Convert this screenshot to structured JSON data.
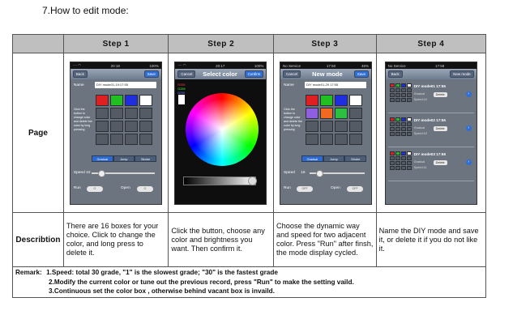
{
  "heading": "7.How to edit mode:",
  "table": {
    "headers": [
      "Step 1",
      "Step 2",
      "Step 3",
      "Step 4"
    ],
    "row_labels": {
      "page": "Page",
      "description": "Describtion"
    },
    "descriptions": [
      "There are 16 boxes for your choice. Click to change the color, and long press to delete it.",
      "Click the button, choose any color and brightness you want. Then confirm it.",
      " Choose the dynamic way and speed for two adjacent color. Press \"Run\" after finsh, the mode display cycled.",
      "Name the DIY mode and save it, or delete it if you do not like it."
    ]
  },
  "remark": {
    "label": "Remark:",
    "lines": [
      "1.Speed: total 30 grade, \"1\" is the slowest grade; \"30\" is the fastest grade",
      "2.Modify the current color or tune out the previous record, press \"Run\" to make the setting vaild.",
      "3.Continuous set the color box , otherwise behind vacant box is invaild."
    ]
  },
  "phones": {
    "step1": {
      "status_left": "∙∙∙∙ ◠",
      "status_time": "20:18",
      "status_right": "100%",
      "back": "Back",
      "save": "Save",
      "name_label": "Name",
      "name_value": "DIY mode01-19:17:55",
      "side_text": "Click the button to change color and delete the color by long pressing",
      "box_colors": [
        "#e02020",
        "#20c020",
        "#1f2fe0",
        "#ffffff"
      ],
      "modes": [
        "Gradual",
        "Jump",
        "Strobe"
      ],
      "mode_selected": 0,
      "speed_label": "Speed 10",
      "run_label": "Run",
      "run_toggle": "O",
      "open_label": "Open",
      "open_toggle": "O"
    },
    "step2": {
      "status_left": "∙∙∙∙ ◠",
      "status_time": "20:17",
      "status_right": "100%",
      "cancel": "Cancel",
      "title": "Select color",
      "confirm": "Confirm",
      "rgb": [
        "R255",
        "G255",
        "B255"
      ]
    },
    "step3": {
      "status_left": "No Service",
      "status_time": "17:50",
      "status_right": "46%",
      "cancel": "Cancel",
      "title": "New mode",
      "save": "Save",
      "name_label": "Name",
      "name_value": "DIY mode01-29 17:55",
      "side_text": "Click the button to change color and delete the color by long pressing",
      "box_colors": [
        "#e02020",
        "#20c020",
        "#1f2fe0",
        "#ffffff",
        "#8f5fe0",
        "#ef6a20",
        "#2cc040"
      ],
      "modes": [
        "Gradual",
        "Jump",
        "Strobe"
      ],
      "mode_selected": 0,
      "speed_label": "Speed",
      "speed_value": "16",
      "run_label": "Run",
      "run_toggle": "OFF",
      "open_label": "Open",
      "open_toggle": "OFF"
    },
    "step4": {
      "status_left": "No Service",
      "status_time": "17:58",
      "status_right": "",
      "back": "Back",
      "new_mode": "New mode",
      "rows": [
        {
          "title": "DIY mode01 17:55",
          "mode": "Gradual",
          "speed": "Speed:10",
          "delete": "Delete",
          "colors": [
            "#e02020",
            "#20c020",
            "#1f2fe0",
            "#ffffff"
          ]
        },
        {
          "title": "DIY mode02 17:56",
          "mode": "Gradual",
          "speed": "Speed:10",
          "delete": "Delete",
          "colors": [
            "#e02020",
            "#20c020",
            "#1f2fe0",
            "#ffffff"
          ]
        },
        {
          "title": "DIY mode03 17:58",
          "mode": "Gradual",
          "speed": "Speed:11",
          "delete": "Delete",
          "colors": [
            "#e02020",
            "#20c020",
            "#1f2fe0",
            "#ffffff"
          ]
        }
      ]
    }
  }
}
